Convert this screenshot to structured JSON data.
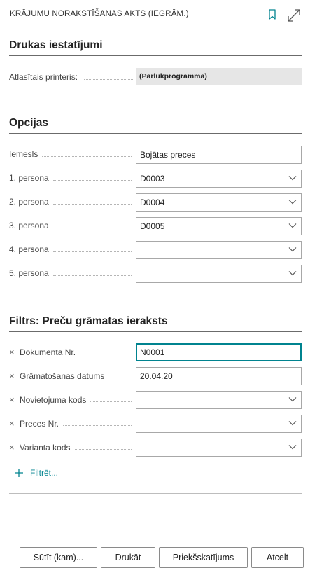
{
  "header": {
    "title": "KRĀJUMU NORAKSTĪŠANAS AKTS (IEGRĀM.)",
    "icons": [
      "bookmark-icon",
      "expand-icon"
    ]
  },
  "print_settings": {
    "section_title": "Drukas iestatījumi",
    "printer_label": "Atlasītais printeris:",
    "printer_value": "(Pārlūkprogramma)"
  },
  "options": {
    "section_title": "Opcijas",
    "fields": [
      {
        "label": "Iemesls",
        "value": "Bojātas preces",
        "type": "text"
      },
      {
        "label": "1. persona",
        "value": "D0003",
        "type": "select"
      },
      {
        "label": "2. persona",
        "value": "D0004",
        "type": "select"
      },
      {
        "label": "3. persona",
        "value": "D0005",
        "type": "select"
      },
      {
        "label": "4. persona",
        "value": "",
        "type": "select"
      },
      {
        "label": "5. persona",
        "value": "",
        "type": "select"
      }
    ]
  },
  "filter": {
    "section_title": "Filtrs: Preču grāmatas ieraksts",
    "remove_symbol": "×",
    "fields": [
      {
        "label": "Dokumenta Nr.",
        "value": "N0001",
        "type": "text"
      },
      {
        "label": "Grāmatošanas datums",
        "value": "20.04.20",
        "type": "text"
      },
      {
        "label": "Novietojuma kods",
        "value": "",
        "type": "select"
      },
      {
        "label": "Preces Nr.",
        "value": "",
        "type": "select"
      },
      {
        "label": "Varianta kods",
        "value": "",
        "type": "select"
      }
    ],
    "add_filter_label": "Filtrēt..."
  },
  "buttons": {
    "send": "Sūtīt (kam)...",
    "print": "Drukāt",
    "preview": "Priekšskatījums",
    "cancel": "Atcelt"
  },
  "colors": {
    "accent": "#00838f",
    "readonly_bg": "#e6e6e6"
  }
}
